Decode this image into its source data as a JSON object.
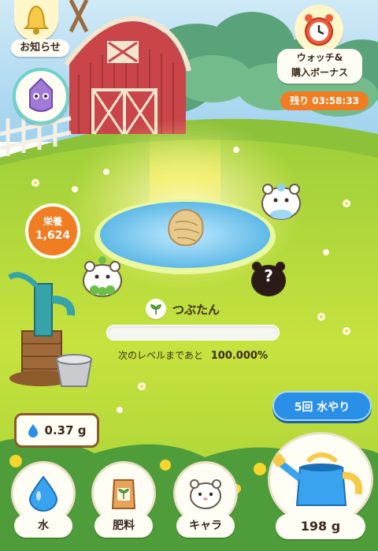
{
  "notice": {
    "label": "お知らせ",
    "icon": "bell-icon"
  },
  "event_icon": {
    "icon": "creature-badge-icon"
  },
  "watch_bonus": {
    "label_line1": "ウォッチ&",
    "label_line2": "購入ボーナス",
    "icon": "alarm-clock-icon",
    "timer": "残り 03:58:33"
  },
  "nutrition": {
    "label": "栄養",
    "value": "1,624"
  },
  "character": {
    "name": "つぶたん",
    "level_prefix": "次のレベルまであと",
    "level_value": "100.000%",
    "progress_fraction": 0.0
  },
  "unknown_character": {
    "mark": "?"
  },
  "water_stock": {
    "value": "0.37 g",
    "icon": "water-drop-icon"
  },
  "water_times_button": {
    "label": "5回 水やり"
  },
  "bottom_nav": [
    {
      "label": "水",
      "icon": "water-drop-icon"
    },
    {
      "label": "肥料",
      "icon": "fertilizer-bag-icon"
    },
    {
      "label": "キャラ",
      "icon": "hamster-face-icon"
    }
  ],
  "watering_can": {
    "amount": "198 g",
    "icon": "watering-can-icon"
  },
  "colors": {
    "grass": "#b9dc3d",
    "sky": "#8cc6e8",
    "barn": "#c9454a",
    "orange": "#f07d22",
    "blue_button": "#2a8fe6",
    "brown": "#8a5a2b"
  }
}
